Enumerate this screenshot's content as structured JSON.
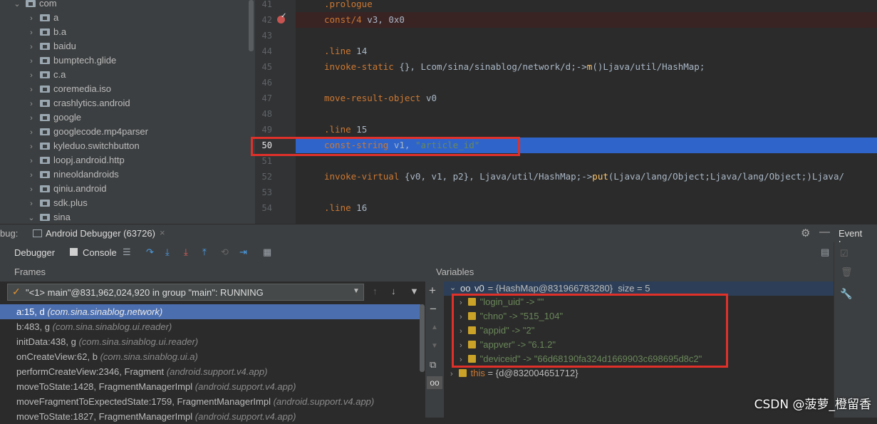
{
  "project_tree": {
    "items": [
      {
        "label": "com",
        "expanded": true,
        "depth": 0
      },
      {
        "label": "a",
        "expanded": false,
        "depth": 1
      },
      {
        "label": "b.a",
        "expanded": false,
        "depth": 1
      },
      {
        "label": "baidu",
        "expanded": false,
        "depth": 1
      },
      {
        "label": "bumptech.glide",
        "expanded": false,
        "depth": 1
      },
      {
        "label": "c.a",
        "expanded": false,
        "depth": 1
      },
      {
        "label": "coremedia.iso",
        "expanded": false,
        "depth": 1
      },
      {
        "label": "crashlytics.android",
        "expanded": false,
        "depth": 1
      },
      {
        "label": "google",
        "expanded": false,
        "depth": 1
      },
      {
        "label": "googlecode.mp4parser",
        "expanded": false,
        "depth": 1
      },
      {
        "label": "kyleduo.switchbutton",
        "expanded": false,
        "depth": 1
      },
      {
        "label": "loopj.android.http",
        "expanded": false,
        "depth": 1
      },
      {
        "label": "nineoldandroids",
        "expanded": false,
        "depth": 1
      },
      {
        "label": "qiniu.android",
        "expanded": false,
        "depth": 1
      },
      {
        "label": "sdk.plus",
        "expanded": false,
        "depth": 1
      },
      {
        "label": "sina",
        "expanded": true,
        "depth": 1
      }
    ]
  },
  "editor": {
    "lines": [
      {
        "num": "41",
        "text": ".prologue",
        "kind": "directive"
      },
      {
        "num": "42",
        "text": "const/4 v3, 0x0",
        "kind": "code",
        "breakpoint": true
      },
      {
        "num": "43",
        "text": "",
        "kind": "blank"
      },
      {
        "num": "44",
        "text": ".line 14",
        "kind": "directive"
      },
      {
        "num": "45",
        "text": "invoke-static {}, Lcom/sina/sinablog/network/d;->m()Ljava/util/HashMap;",
        "kind": "code"
      },
      {
        "num": "46",
        "text": "",
        "kind": "blank"
      },
      {
        "num": "47",
        "text": "move-result-object v0",
        "kind": "code"
      },
      {
        "num": "48",
        "text": "",
        "kind": "blank"
      },
      {
        "num": "49",
        "text": ".line 15",
        "kind": "directive"
      },
      {
        "num": "50",
        "text": "const-string v1, \"article_id\"",
        "kind": "code",
        "current": true
      },
      {
        "num": "51",
        "text": "",
        "kind": "blank"
      },
      {
        "num": "52",
        "text": "invoke-virtual {v0, v1, p2}, Ljava/util/HashMap;->put(Ljava/lang/Object;Ljava/lang/Object;)Ljava/",
        "kind": "code"
      },
      {
        "num": "53",
        "text": "",
        "kind": "blank"
      },
      {
        "num": "54",
        "text": ".line 16",
        "kind": "directive"
      }
    ]
  },
  "debug": {
    "tool_label": "bug:",
    "session_tab": "Android Debugger (63726)",
    "close_glyph": "×",
    "event_log": "Event Log",
    "tabs": {
      "debugger": "Debugger",
      "console": "Console"
    }
  },
  "frames": {
    "header": "Frames",
    "thread_select": "\"<1> main\"@831,962,024,920 in group \"main\": RUNNING",
    "items": [
      {
        "method": "a:15, d",
        "pkg": "(com.sina.sinablog.network)",
        "selected": true
      },
      {
        "method": "b:483, g",
        "pkg": "(com.sina.sinablog.ui.reader)"
      },
      {
        "method": "initData:438, g",
        "pkg": "(com.sina.sinablog.ui.reader)"
      },
      {
        "method": "onCreateView:62, b",
        "pkg": "(com.sina.sinablog.ui.a)"
      },
      {
        "method": "performCreateView:2346, Fragment",
        "pkg": "(android.support.v4.app)"
      },
      {
        "method": "moveToState:1428, FragmentManagerImpl",
        "pkg": "(android.support.v4.app)"
      },
      {
        "method": "moveFragmentToExpectedState:1759, FragmentManagerImpl",
        "pkg": "(android.support.v4.app)"
      },
      {
        "method": "moveToState:1827, FragmentManagerImpl",
        "pkg": "(android.support.v4.app)"
      }
    ]
  },
  "variables": {
    "header": "Variables",
    "root": {
      "name": "v0",
      "value": " = {HashMap@831966783280}  size = 5"
    },
    "entries": [
      {
        "text": "\"login_uid\" -> \"\""
      },
      {
        "text": "\"chno\" -> \"515_104\""
      },
      {
        "text": "\"appid\" -> \"2\""
      },
      {
        "text": "\"appver\" -> \"6.1.2\""
      },
      {
        "text": "\"deviceid\" -> \"66d68190fa324d1669903c698695d8c2\""
      }
    ],
    "this_row": {
      "name": "this",
      "value": " = {d@832004651712}"
    }
  },
  "watermark": "CSDN @菠萝_橙留香",
  "colors": {
    "accent": "#4b6eaf",
    "highlight": "#2f65ca",
    "annotation": "#e0302a"
  }
}
